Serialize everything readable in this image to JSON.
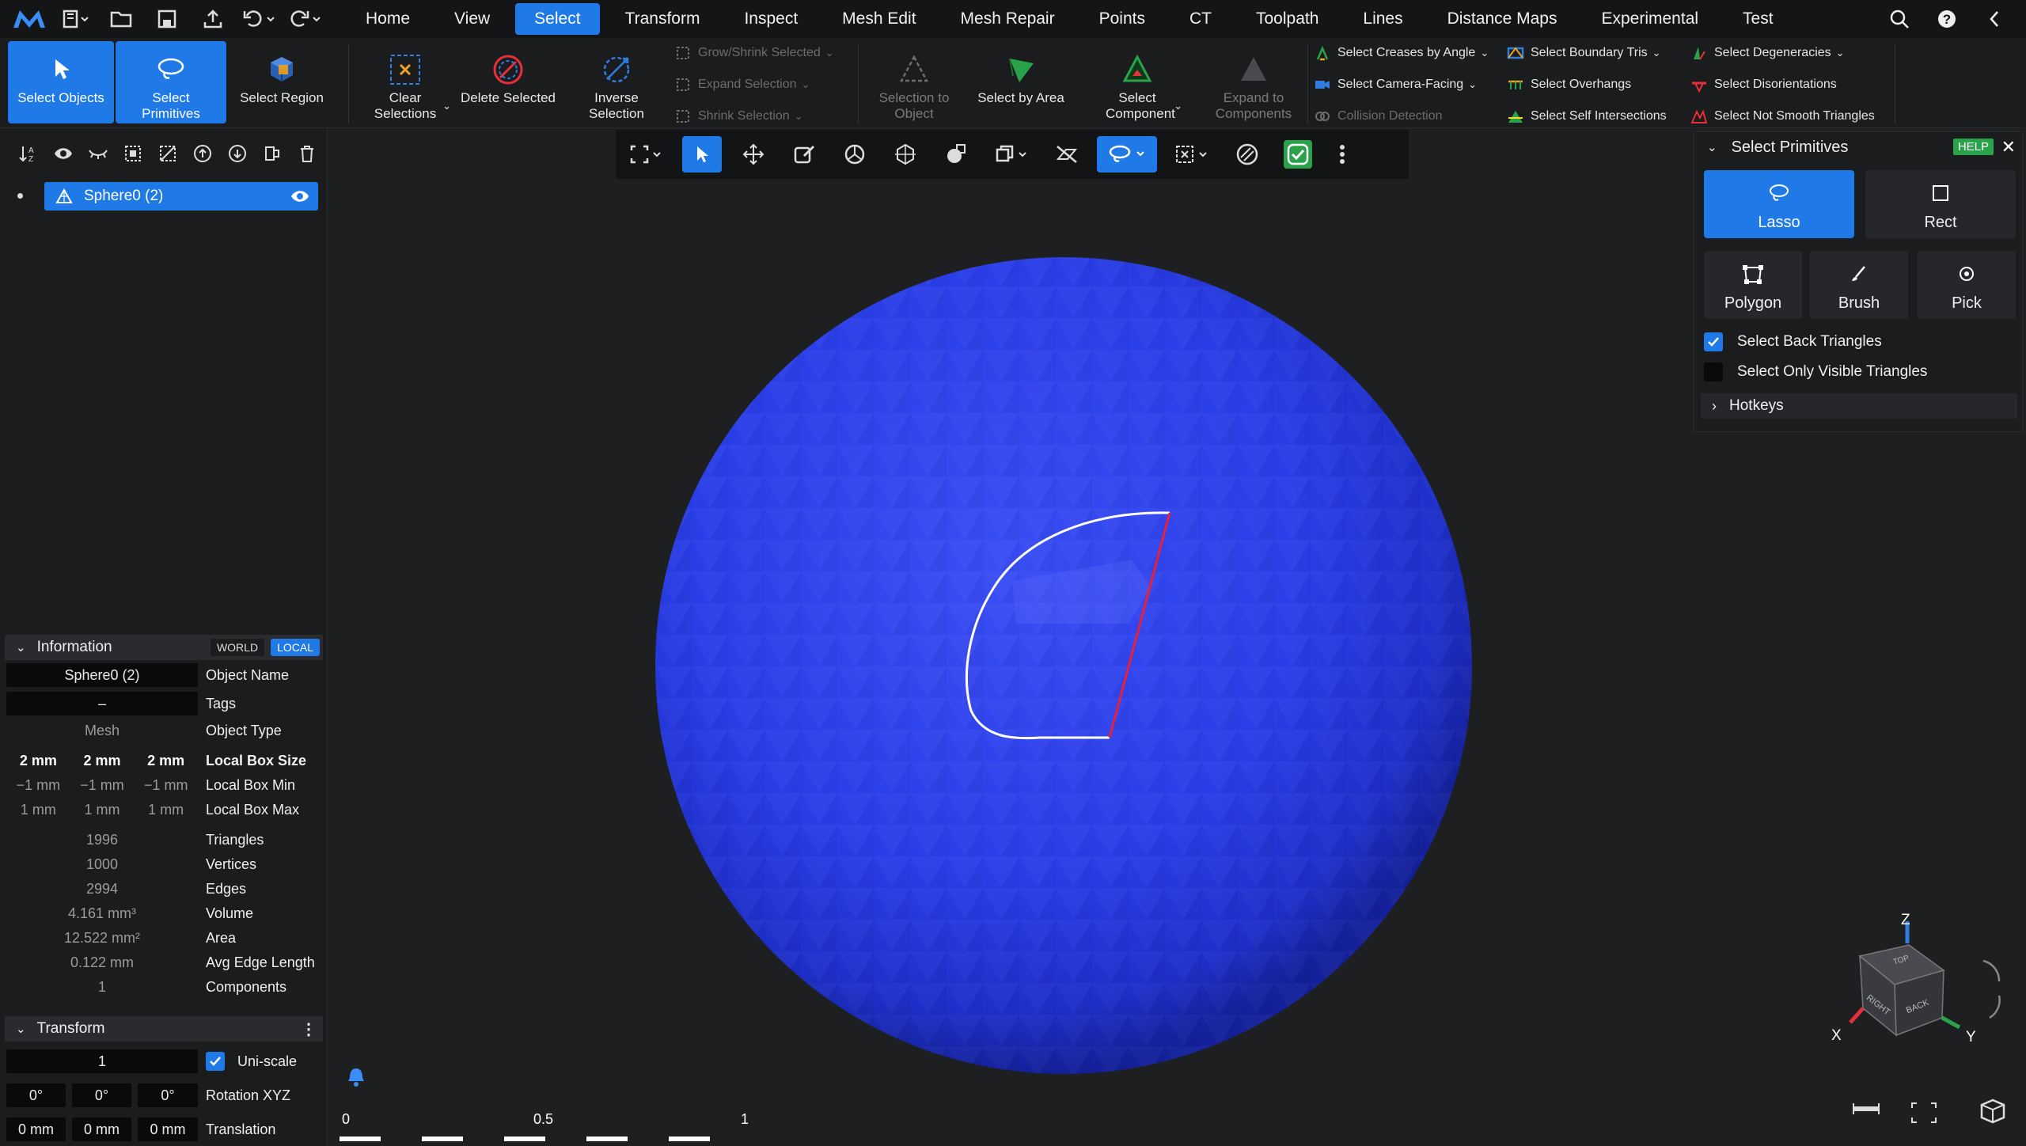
{
  "menubar": {
    "tabs": [
      "Home",
      "View",
      "Select",
      "Transform",
      "Inspect",
      "Mesh Edit",
      "Mesh Repair",
      "Points",
      "CT",
      "Toolpath",
      "Lines",
      "Distance Maps",
      "Experimental",
      "Test"
    ],
    "active_tab": "Select"
  },
  "ribbon": {
    "select_objects": "Select Objects",
    "select_primitives": "Select Primitives",
    "select_region": "Select Region",
    "clear_selections": "Clear Selections",
    "delete_selected": "Delete Selected",
    "inverse_selection": "Inverse Selection",
    "grow_shrink": "Grow/Shrink Selected",
    "expand_selection": "Expand Selection",
    "shrink_selection": "Shrink Selection",
    "selection_to_object": "Selection to Object",
    "select_by_area": "Select by Area",
    "select_component": "Select Component",
    "expand_to_components": "Expand to Components",
    "select_creases": "Select Creases by Angle",
    "select_camera_facing": "Select Camera-Facing",
    "collision_detection": "Collision Detection",
    "select_boundary_tris": "Select Boundary Tris",
    "select_overhangs": "Select Overhangs",
    "select_self_intersections": "Select Self Intersections",
    "select_degeneracies": "Select Degeneracies",
    "select_disorientations": "Select Disorientations",
    "select_not_smooth": "Select Not Smooth Triangles"
  },
  "scene": {
    "object_name": "Sphere0 (2)"
  },
  "information": {
    "title": "Information",
    "world": "WORLD",
    "local": "LOCAL",
    "object_name_value": "Sphere0 (2)",
    "object_name_label": "Object Name",
    "tags_value": "–",
    "tags_label": "Tags",
    "object_type_value": "Mesh",
    "object_type_label": "Object Type",
    "box_size": [
      "2 mm",
      "2 mm",
      "2 mm"
    ],
    "box_size_label": "Local Box Size",
    "box_min": [
      "−1 mm",
      "−1 mm",
      "−1 mm"
    ],
    "box_min_label": "Local Box Min",
    "box_max": [
      "1 mm",
      "1 mm",
      "1 mm"
    ],
    "box_max_label": "Local Box Max",
    "triangles": "1996",
    "triangles_label": "Triangles",
    "vertices": "1000",
    "vertices_label": "Vertices",
    "edges": "2994",
    "edges_label": "Edges",
    "volume": "4.161 mm³",
    "volume_label": "Volume",
    "area": "12.522 mm²",
    "area_label": "Area",
    "avg_edge": "0.122 mm",
    "avg_edge_label": "Avg Edge Length",
    "components": "1",
    "components_label": "Components"
  },
  "transform": {
    "title": "Transform",
    "scale": "1",
    "uniscale_label": "Uni-scale",
    "rotation": [
      "0°",
      "0°",
      "0°"
    ],
    "rotation_label": "Rotation XYZ",
    "translation": [
      "0 mm",
      "0 mm",
      "0 mm"
    ],
    "translation_label": "Translation"
  },
  "select_panel": {
    "title": "Select Primitives",
    "help": "HELP",
    "modes": [
      "Lasso",
      "Rect",
      "Polygon",
      "Brush",
      "Pick"
    ],
    "active_mode": "Lasso",
    "select_back_triangles": "Select Back Triangles",
    "select_back_checked": true,
    "select_only_visible": "Select Only Visible Triangles",
    "select_only_visible_checked": false,
    "hotkeys": "Hotkeys"
  },
  "scale_bar": {
    "labels": [
      "0",
      "0.5",
      "1"
    ]
  },
  "axes": {
    "z": "Z",
    "x": "X",
    "y": "Y",
    "cube_top": "TOP",
    "cube_right": "RIGHT",
    "cube_back": "BACK"
  },
  "colors": {
    "accent": "#1f7ae8",
    "sphere": "#2b3ee8",
    "lasso": "#ffffff",
    "lasso_close": "#e8203a",
    "help_green": "#2aa24a"
  }
}
